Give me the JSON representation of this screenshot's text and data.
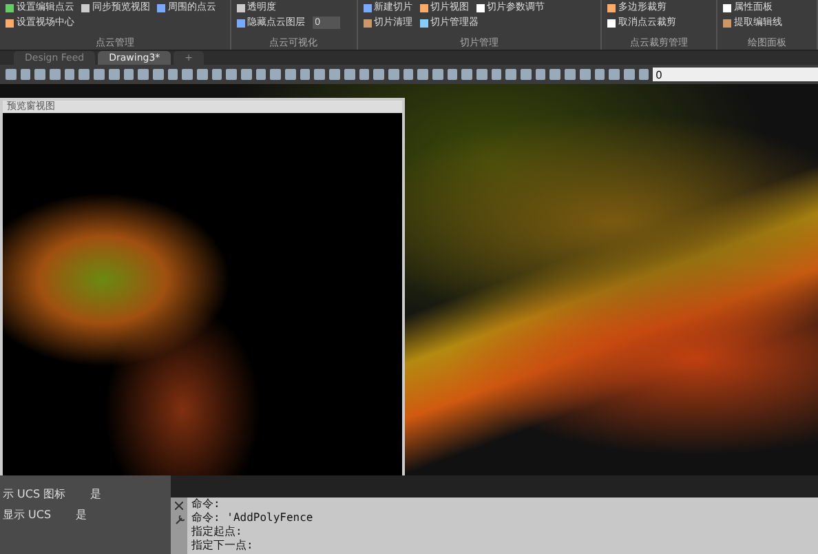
{
  "ribbon": {
    "groups": [
      {
        "title": "点云管理",
        "buttons": [
          "设置编辑点云",
          "同步预览视图",
          "周围的点云",
          "设置视场中心"
        ]
      },
      {
        "title": "点云可视化",
        "buttons": [
          "透明度",
          "隐藏点云图层"
        ],
        "field": "0"
      },
      {
        "title": "切片管理",
        "buttons": [
          "新建切片",
          "切片视图",
          "切片参数调节",
          "切片清理",
          "切片管理器"
        ]
      },
      {
        "title": "点云裁剪管理",
        "buttons": [
          "多边形裁剪",
          "取消点云裁剪"
        ]
      },
      {
        "title": "绘图面板",
        "buttons": [
          "属性面板",
          "提取编辑线"
        ]
      }
    ]
  },
  "tabs": [
    {
      "label": "Design Feed",
      "selected": false
    },
    {
      "label": "Drawing3*",
      "selected": true
    }
  ],
  "new_tab": "+",
  "layer_field": "0",
  "preview_window": {
    "title": "预览窗视图"
  },
  "properties": [
    {
      "name": "示 UCS 图标",
      "value": "是"
    },
    {
      "name": "显示 UCS",
      "value": "是"
    }
  ],
  "command_lines": [
    "命令:",
    "命令: 'AddPolyFence",
    "指定起点:",
    "指定下一点:"
  ]
}
